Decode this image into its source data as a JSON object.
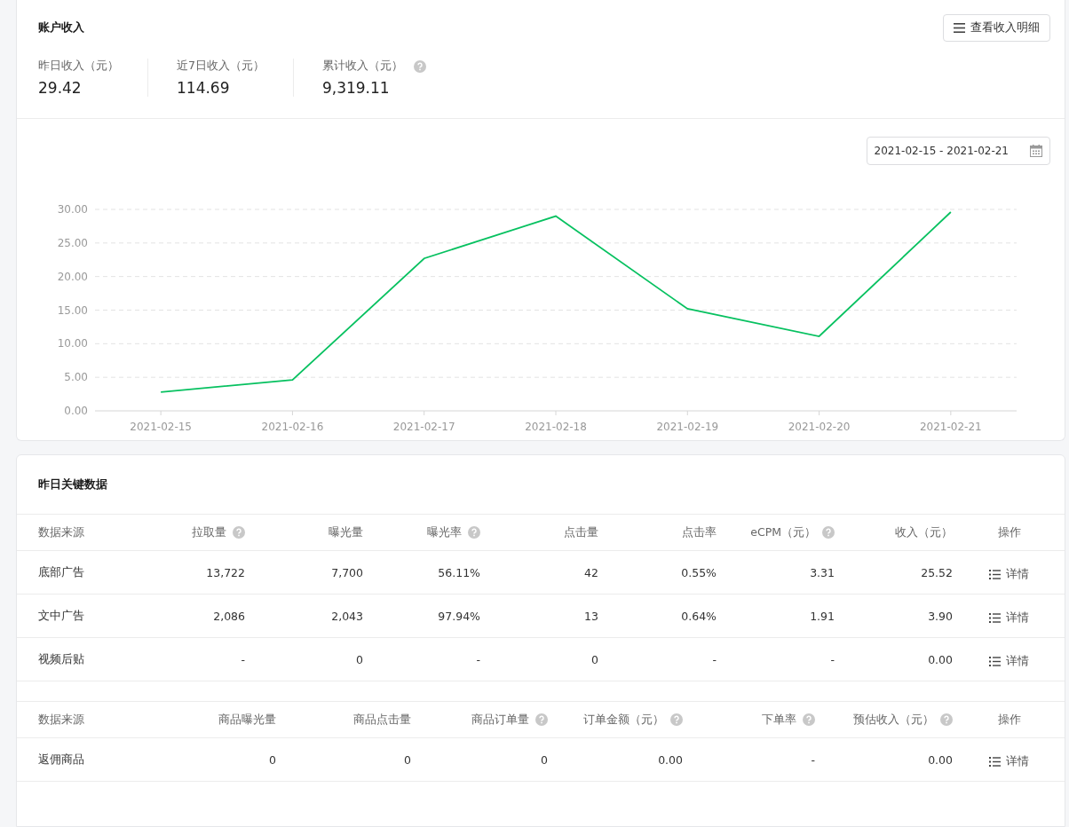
{
  "income": {
    "title": "账户收入",
    "detail_button": "查看收入明细",
    "stats": [
      {
        "label": "昨日收入（元）",
        "value": "29.42",
        "help": false
      },
      {
        "label": "近7日收入（元）",
        "value": "114.69",
        "help": false
      },
      {
        "label": "累计收入（元）",
        "value": "9,319.11",
        "help": true
      }
    ],
    "date_range": "2021-02-15 - 2021-02-21",
    "chart_data": {
      "type": "line",
      "categories": [
        "2021-02-15",
        "2021-02-16",
        "2021-02-17",
        "2021-02-18",
        "2021-02-19",
        "2021-02-20",
        "2021-02-21"
      ],
      "grid": true,
      "series": [
        {
          "color": "#07c160",
          "values": [
            2.8,
            4.6,
            22.7,
            29.0,
            15.2,
            11.1,
            29.6
          ]
        }
      ],
      "ylim": [
        0,
        30
      ],
      "yticks": [
        {
          "value": 0,
          "label": "0.00"
        },
        {
          "value": 5,
          "label": "5.00"
        },
        {
          "value": 10,
          "label": "10.00"
        },
        {
          "value": 15,
          "label": "15.00"
        },
        {
          "value": 20,
          "label": "20.00"
        },
        {
          "value": 25,
          "label": "25.00"
        },
        {
          "value": 30,
          "label": "30.00"
        }
      ]
    }
  },
  "key_data": {
    "title": "昨日关键数据",
    "tables": [
      {
        "columns": [
          {
            "label": "数据来源",
            "help": false
          },
          {
            "label": "拉取量",
            "help": true
          },
          {
            "label": "曝光量",
            "help": false
          },
          {
            "label": "曝光率",
            "help": true
          },
          {
            "label": "点击量",
            "help": false
          },
          {
            "label": "点击率",
            "help": false
          },
          {
            "label": "eCPM（元）",
            "help": true
          },
          {
            "label": "收入（元）",
            "help": false
          },
          {
            "label": "操作",
            "help": false
          }
        ],
        "rows": [
          {
            "cells": [
              "底部广告",
              "13,722",
              "7,700",
              "56.11%",
              "42",
              "0.55%",
              "3.31",
              "25.52"
            ],
            "action": "详情"
          },
          {
            "cells": [
              "文中广告",
              "2,086",
              "2,043",
              "97.94%",
              "13",
              "0.64%",
              "1.91",
              "3.90"
            ],
            "action": "详情"
          },
          {
            "cells": [
              "视频后贴",
              "-",
              "0",
              "-",
              "0",
              "-",
              "-",
              "0.00"
            ],
            "action": "详情"
          }
        ]
      },
      {
        "columns": [
          {
            "label": "数据来源",
            "help": false
          },
          {
            "label": "商品曝光量",
            "help": false
          },
          {
            "label": "商品点击量",
            "help": false
          },
          {
            "label": "商品订单量",
            "help": true
          },
          {
            "label": "订单金额（元）",
            "help": true
          },
          {
            "label": "下单率",
            "help": true
          },
          {
            "label": "预估收入（元）",
            "help": true
          },
          {
            "label": "操作",
            "help": false
          }
        ],
        "rows": [
          {
            "cells": [
              "返佣商品",
              "0",
              "0",
              "0",
              "0.00",
              "-",
              "0.00"
            ],
            "action": "详情"
          }
        ]
      }
    ]
  }
}
